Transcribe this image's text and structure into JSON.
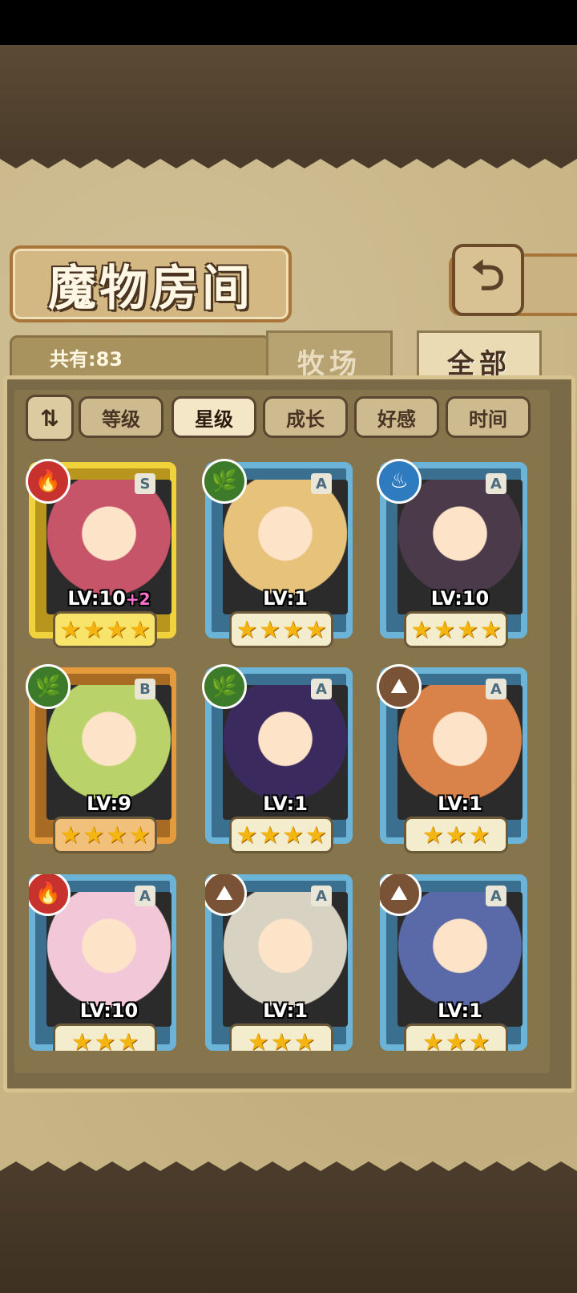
{
  "header": {
    "title": "魔物房间",
    "back_icon": "return-arrow-icon"
  },
  "summary": {
    "count_label": "共有:83"
  },
  "tabs": [
    {
      "label": "牧场",
      "active": false
    },
    {
      "label": "全部",
      "active": true
    }
  ],
  "sort": {
    "toggle_icon": "sort-order-icon",
    "toggle_glyph": "⇅",
    "buttons": [
      {
        "label": "等级",
        "active": false
      },
      {
        "label": "星级",
        "active": true
      },
      {
        "label": "成长",
        "active": false
      },
      {
        "label": "好感",
        "active": false
      },
      {
        "label": "时间",
        "active": false
      }
    ]
  },
  "monsters": [
    {
      "rank": "S",
      "element": "fire",
      "element_glyph": "🔥",
      "level": "LV:10",
      "bonus": "+2",
      "stars": 4,
      "frame": "gold"
    },
    {
      "rank": "A",
      "element": "nature",
      "element_glyph": "🌿",
      "level": "LV:1",
      "bonus": "",
      "stars": 4,
      "frame": "blue"
    },
    {
      "rank": "A",
      "element": "water",
      "element_glyph": "♨",
      "level": "LV:10",
      "bonus": "",
      "stars": 4,
      "frame": "blue"
    },
    {
      "rank": "B",
      "element": "nature",
      "element_glyph": "🌿",
      "level": "LV:9",
      "bonus": "",
      "stars": 4,
      "frame": "orange"
    },
    {
      "rank": "A",
      "element": "nature",
      "element_glyph": "🌿",
      "level": "LV:1",
      "bonus": "",
      "stars": 4,
      "frame": "blue"
    },
    {
      "rank": "A",
      "element": "earth",
      "element_glyph": "⛰",
      "level": "LV:1",
      "bonus": "",
      "stars": 3,
      "frame": "blue"
    },
    {
      "rank": "A",
      "element": "fire",
      "element_glyph": "🔥",
      "level": "LV:10",
      "bonus": "",
      "stars": 3,
      "frame": "blue"
    },
    {
      "rank": "A",
      "element": "earth",
      "element_glyph": "⛰",
      "level": "LV:1",
      "bonus": "",
      "stars": 3,
      "frame": "blue"
    },
    {
      "rank": "A",
      "element": "earth",
      "element_glyph": "⛰",
      "level": "LV:1",
      "bonus": "",
      "stars": 3,
      "frame": "blue"
    }
  ],
  "colors": {
    "fire": "#c8322e",
    "nature": "#3d7a2a",
    "water": "#2f7bbf",
    "earth": "#7a5236",
    "portraits": [
      "#c7556a",
      "#e6c27a",
      "#4a3a4a",
      "#b9d36a",
      "#3b2a5e",
      "#d9834a",
      "#f2c8d8",
      "#d8d2c2",
      "#5a6aa8"
    ]
  }
}
